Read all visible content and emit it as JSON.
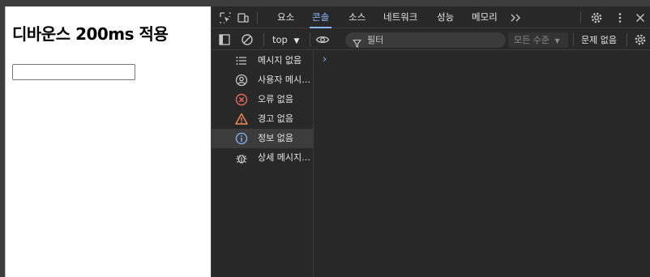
{
  "page": {
    "title": "디바운스 200ms 적용",
    "input_value": ""
  },
  "devtools": {
    "tabs": [
      {
        "label": "요소",
        "active": false
      },
      {
        "label": "콘솔",
        "active": true
      },
      {
        "label": "소스",
        "active": false
      },
      {
        "label": "네트워크",
        "active": false
      },
      {
        "label": "성능",
        "active": false
      },
      {
        "label": "메모리",
        "active": false
      }
    ],
    "icons": {
      "inspect": "inspect-element-icon",
      "device": "device-toggle-icon",
      "more_tabs": "more-tabs-icon",
      "settings": "gear-icon",
      "menu": "kebab-menu-icon",
      "close": "close-icon"
    },
    "toolbar": {
      "context": "top",
      "filter_placeholder": "필터",
      "level": "모든 수준",
      "issues": "문제 없음"
    },
    "sidebar": [
      {
        "label": "메시지 없음",
        "icon": "list-icon",
        "selected": false
      },
      {
        "label": "사용자 메시지 없음",
        "icon": "user-icon",
        "selected": false
      },
      {
        "label": "오류 없음",
        "icon": "error-icon",
        "selected": false
      },
      {
        "label": "경고 없음",
        "icon": "warning-icon",
        "selected": false
      },
      {
        "label": "정보 없음",
        "icon": "info-icon",
        "selected": true
      },
      {
        "label": "상세 메시지 없음",
        "icon": "bug-icon",
        "selected": false
      }
    ],
    "colors": {
      "accent": "#8ab4f8",
      "error": "#e46962",
      "warning": "#f28b54",
      "background": "#282828"
    }
  }
}
